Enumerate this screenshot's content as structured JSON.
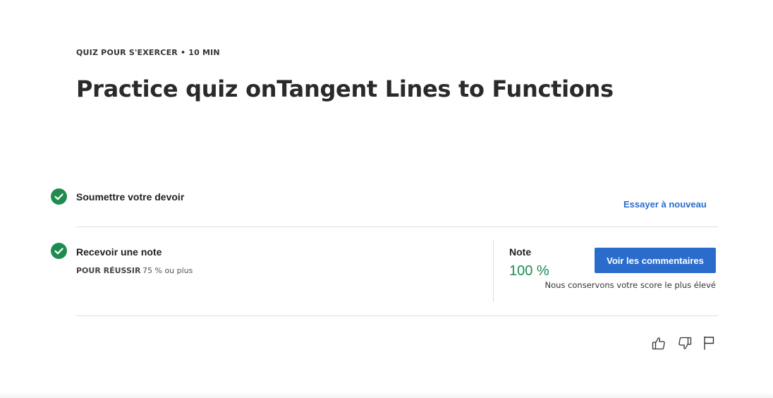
{
  "header": {
    "meta": "QUIZ POUR S'EXERCER • 10  MIN",
    "title": "Practice quiz onTangent Lines to Functions"
  },
  "submit_step": {
    "label": "Soumettre votre devoir",
    "retry_label": "Essayer à nouveau"
  },
  "grade_step": {
    "label": "Recevoir une note",
    "pass_label": "POUR RÉUSSIR",
    "pass_value": "75 % ou plus",
    "grade_label": "Note",
    "grade_value": "100 %",
    "feedback_button": "Voir les commentaires",
    "keep_note": "Nous conservons votre score le plus élevé"
  },
  "icons": {
    "step_complete": "check-circle-icon",
    "like": "thumbs-up-icon",
    "dislike": "thumbs-down-icon",
    "report": "flag-icon"
  },
  "colors": {
    "accent": "#2a6ccc",
    "success": "#1e8c4e"
  }
}
